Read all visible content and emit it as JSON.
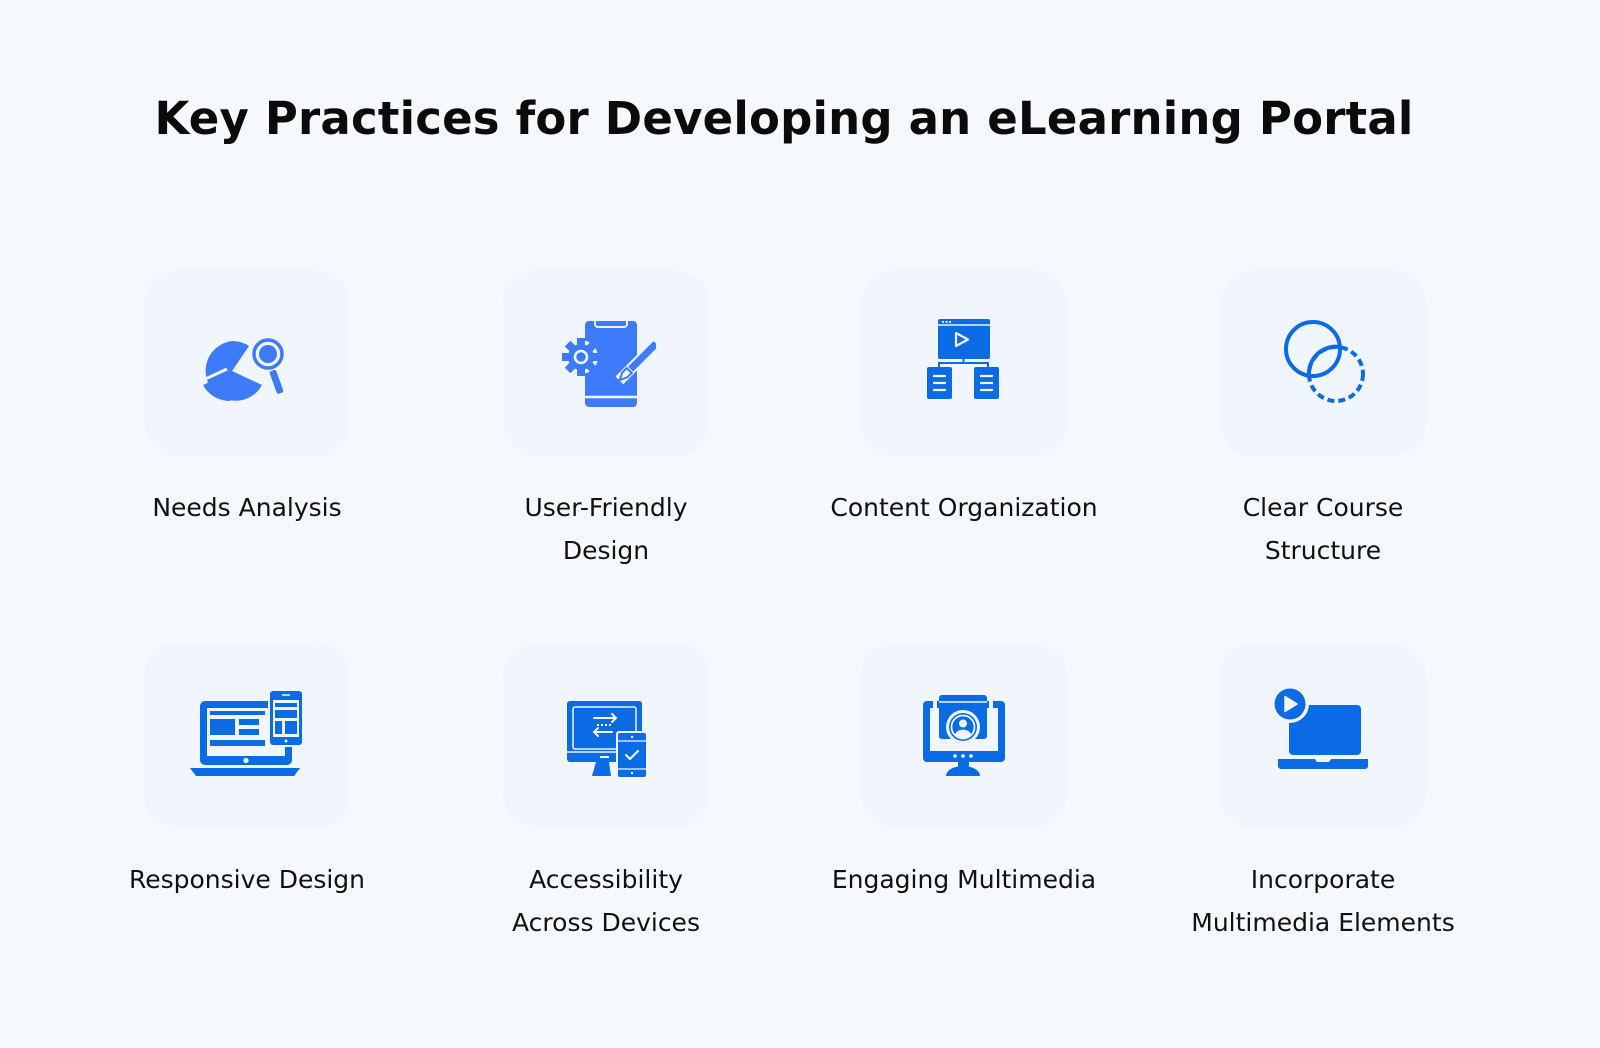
{
  "title": "Key Practices for Developing an eLearning Portal",
  "colors": {
    "background": "#F5F8FC",
    "tile": "#F1F6FE",
    "icon_bright": "#3D7BFA",
    "icon_deep": "#0A6BE4",
    "text": "#111111"
  },
  "practices": [
    {
      "label": "Needs Analysis",
      "icon": "pie-chart-magnifier-icon"
    },
    {
      "label": "User-Friendly Design",
      "icon": "phone-gear-pen-icon"
    },
    {
      "label": "Content Organization",
      "icon": "video-hierarchy-icon"
    },
    {
      "label": "Clear Course Structure",
      "icon": "overlapping-circles-icon"
    },
    {
      "label": "Responsive Design",
      "icon": "laptop-phone-icon"
    },
    {
      "label": "Accessibility Across Devices",
      "icon": "monitor-phone-sync-icon"
    },
    {
      "label": "Engaging Multimedia",
      "icon": "monitor-user-video-icon"
    },
    {
      "label": "Incorporate Multimedia Elements",
      "icon": "laptop-play-icon"
    }
  ]
}
